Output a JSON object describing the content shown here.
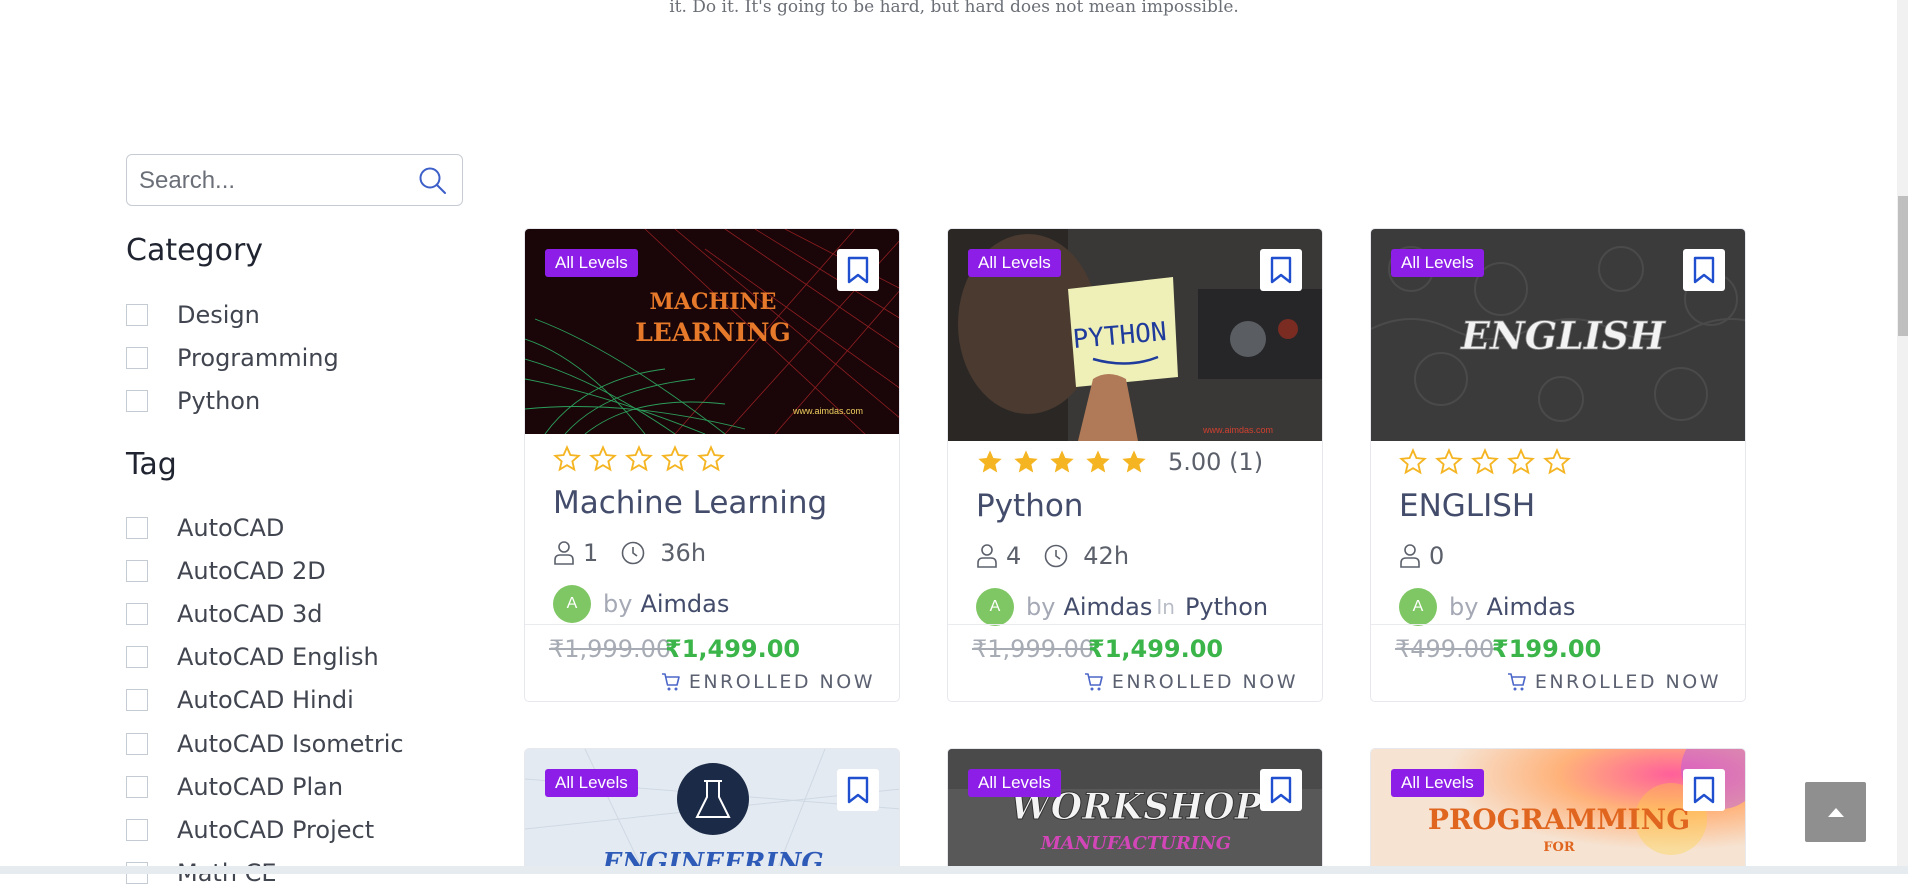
{
  "quote": "it. Do it. It's going to be hard, but hard does not mean impossible.",
  "search": {
    "placeholder": "Search..."
  },
  "category": {
    "title": "Category",
    "items": [
      "Design",
      "Programming",
      "Python"
    ]
  },
  "tag": {
    "title": "Tag",
    "items": [
      "AutoCAD",
      "AutoCAD 2D",
      "AutoCAD 3d",
      "AutoCAD English",
      "AutoCAD Hindi",
      "AutoCAD Isometric",
      "AutoCAD Plan",
      "AutoCAD Project",
      "Math CE"
    ]
  },
  "colors": {
    "badge": "#8c1ee8",
    "price": "#3bb54a",
    "star": "#f5b523",
    "title": "#434c6b"
  },
  "courses": [
    {
      "level": "All Levels",
      "thumb_text": [
        "MACHINE",
        "LEARNING"
      ],
      "thumb_url": "www.aimdas.com",
      "rating": 0,
      "rating_text": "",
      "title": "Machine Learning",
      "students": "1",
      "duration": "36h",
      "avatar": "A",
      "by": "by",
      "author": "Aimdas",
      "in_label": "",
      "category": "",
      "old_price": "₹1,999.00",
      "new_price": "₹1,499.00",
      "cta": "ENROLLED NOW"
    },
    {
      "level": "All Levels",
      "thumb_text": [
        "PYTHON"
      ],
      "thumb_url": "www.aimdas.com",
      "rating": 5,
      "rating_text": "5.00 (1)",
      "title": "Python",
      "students": "4",
      "duration": "42h",
      "avatar": "A",
      "by": "by",
      "author": "Aimdas",
      "in_label": "In",
      "category": "Python",
      "old_price": "₹1,999.00",
      "new_price": "₹1,499.00",
      "cta": "ENROLLED NOW"
    },
    {
      "level": "All Levels",
      "thumb_text": [
        "ENGLISH"
      ],
      "thumb_url": "",
      "rating": 0,
      "rating_text": "",
      "title": "ENGLISH",
      "students": "0",
      "duration": "",
      "avatar": "A",
      "by": "by",
      "author": "Aimdas",
      "in_label": "",
      "category": "",
      "old_price": "₹499.00",
      "new_price": "₹199.00",
      "cta": "ENROLLED NOW"
    }
  ],
  "next_row": [
    {
      "level": "All Levels",
      "thumb_text": "ENGINEERING"
    },
    {
      "level": "All Levels",
      "thumb_text": "WORKSHOP",
      "thumb_sub": "MANUFACTURING"
    },
    {
      "level": "All Levels",
      "thumb_text": "PROGRAMMING",
      "thumb_sub": "FOR"
    }
  ]
}
